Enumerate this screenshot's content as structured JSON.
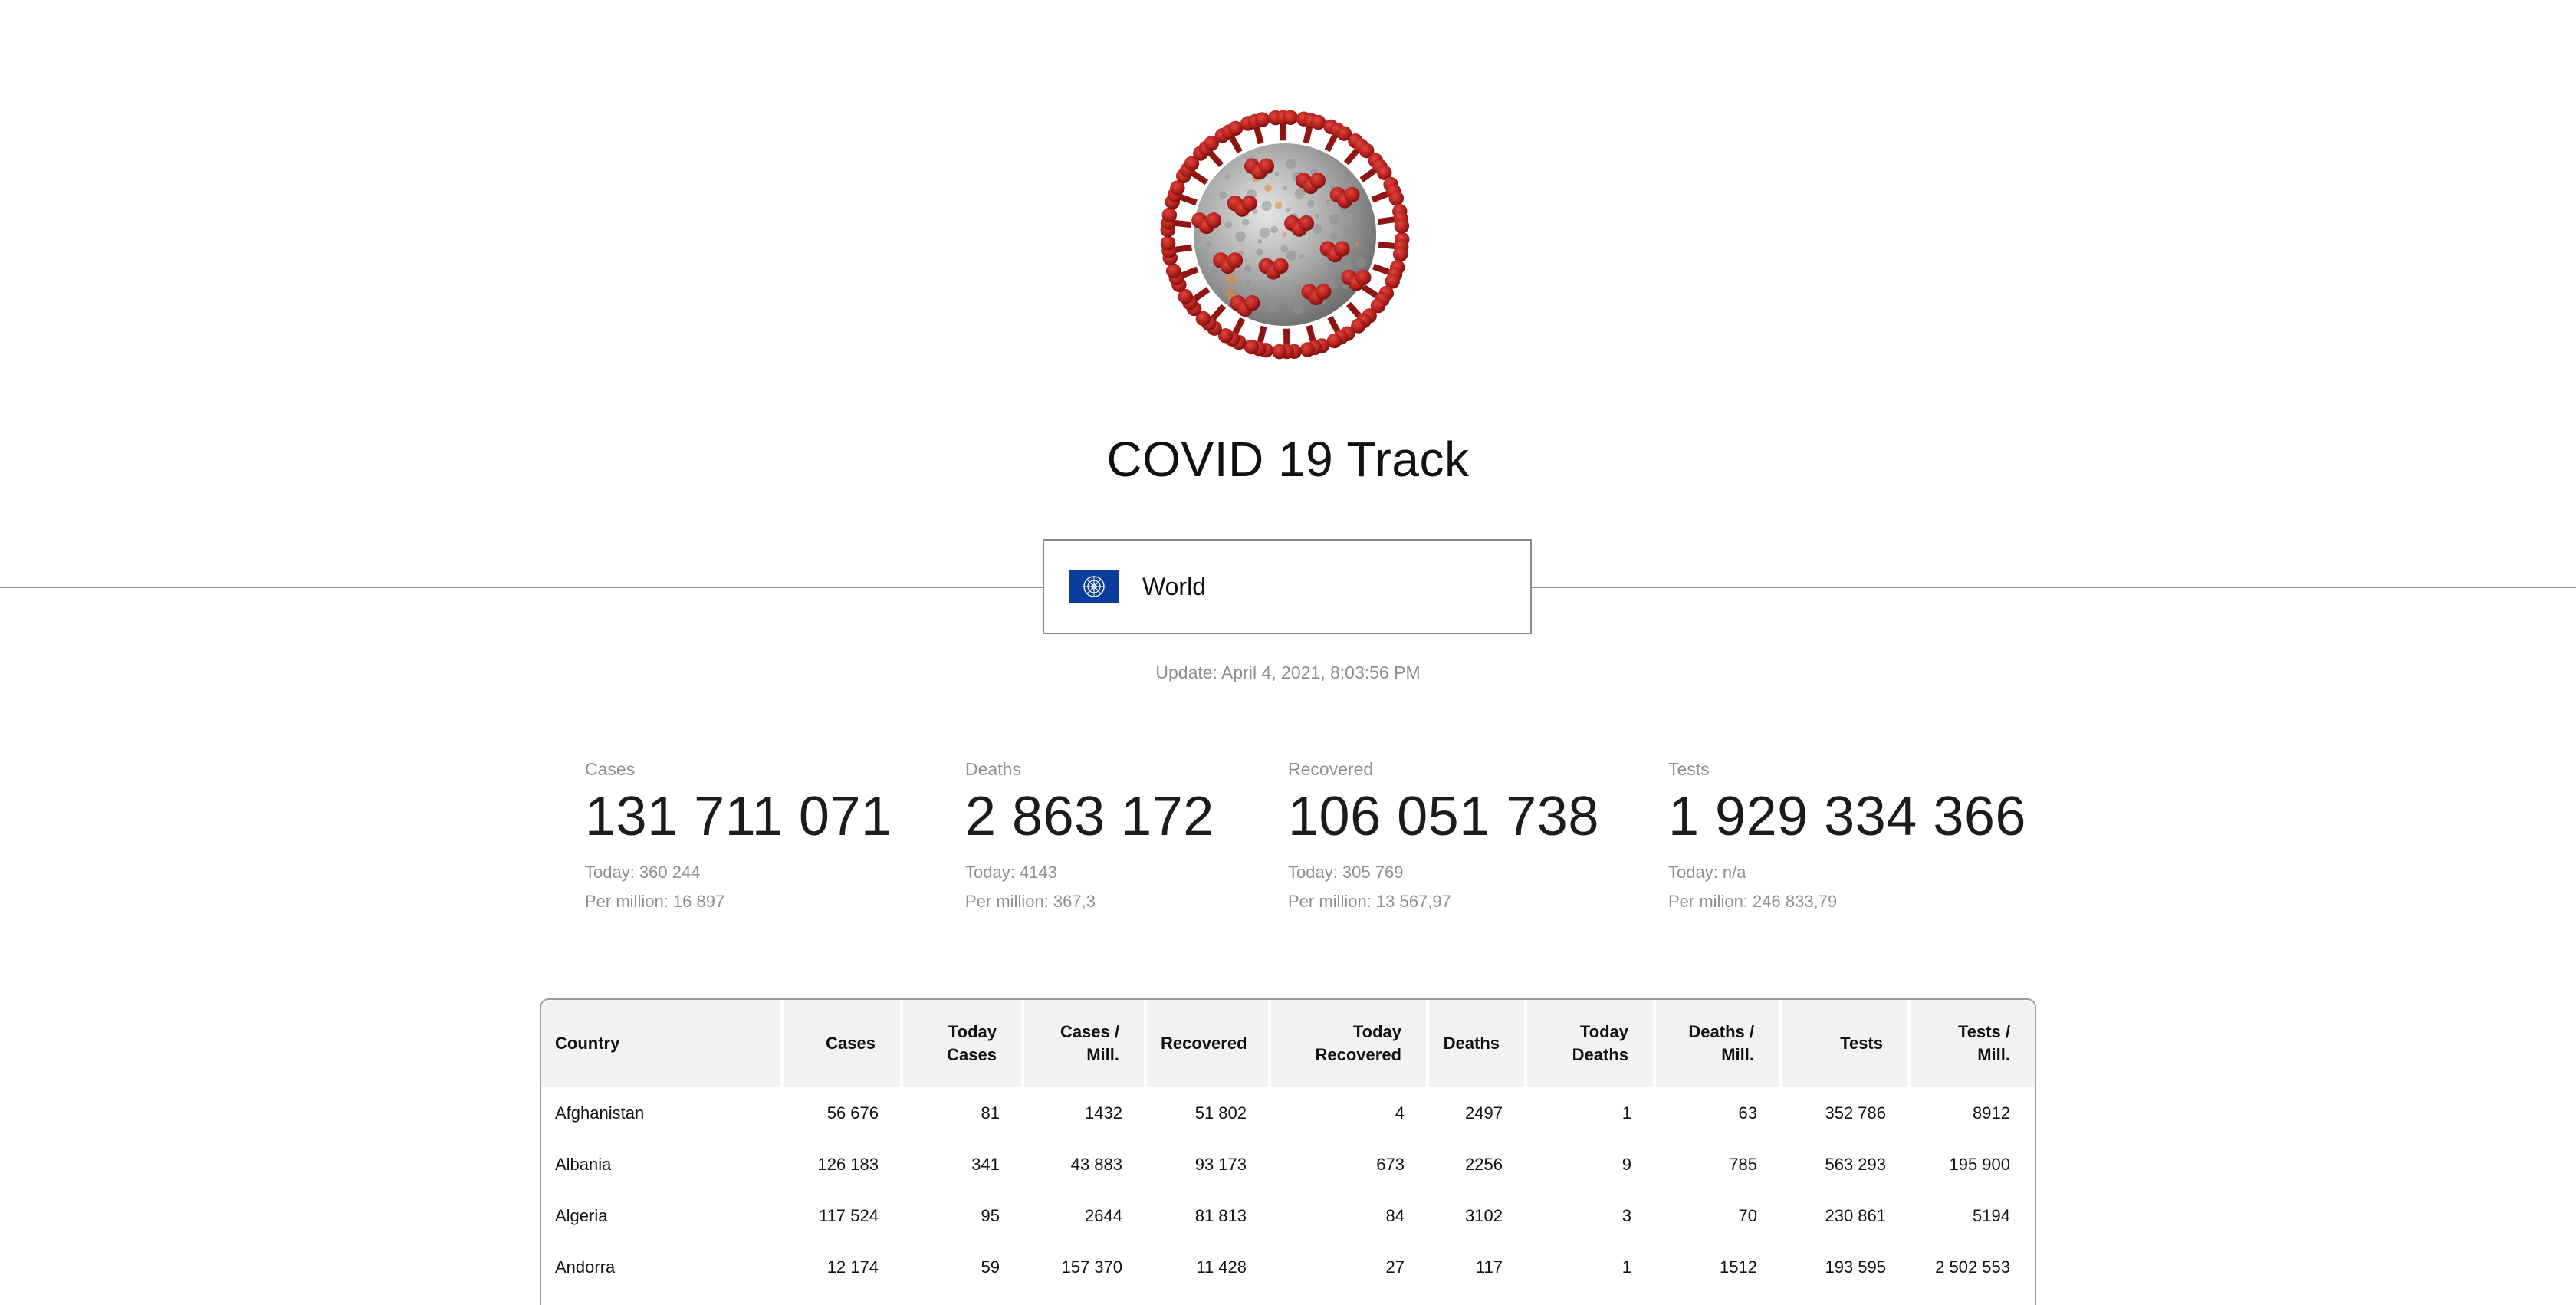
{
  "app": {
    "title": "COVID 19 Track"
  },
  "selector": {
    "label": "World",
    "flag_color": "#0b3e9c"
  },
  "update_text": "Update: April 4, 2021, 8:03:56 PM",
  "stats": [
    {
      "label": "Cases",
      "value": "131 711 071",
      "today": "Today: 360 244",
      "per": "Per million: 16 897"
    },
    {
      "label": "Deaths",
      "value": "2 863 172",
      "today": "Today: 4143",
      "per": "Per million: 367,3"
    },
    {
      "label": "Recovered",
      "value": "106 051 738",
      "today": "Today: 305 769",
      "per": "Per million: 13 567,97"
    },
    {
      "label": "Tests",
      "value": "1 929 334 366",
      "today": "Today: n/a",
      "per": "Per milion: 246 833,79"
    }
  ],
  "table": {
    "headers": {
      "country": "Country",
      "cases": "Cases",
      "today_cases_1": "Today",
      "today_cases_2": "Cases",
      "cases_mill_1": "Cases /",
      "cases_mill_2": "Mill.",
      "recovered": "Recovered",
      "today_recovered_1": "Today",
      "today_recovered_2": "Recovered",
      "deaths": "Deaths",
      "today_deaths_1": "Today",
      "today_deaths_2": "Deaths",
      "deaths_mill_1": "Deaths /",
      "deaths_mill_2": "Mill.",
      "tests": "Tests",
      "tests_mill_1": "Tests /",
      "tests_mill_2": "Mill."
    },
    "rows": [
      {
        "country": "Afghanistan",
        "cases": "56 676",
        "today_cases": "81",
        "cases_mill": "1432",
        "recovered": "51 802",
        "today_recovered": "4",
        "deaths": "2497",
        "today_deaths": "1",
        "deaths_mill": "63",
        "tests": "352 786",
        "tests_mill": "8912"
      },
      {
        "country": "Albania",
        "cases": "126 183",
        "today_cases": "341",
        "cases_mill": "43 883",
        "recovered": "93 173",
        "today_recovered": "673",
        "deaths": "2256",
        "today_deaths": "9",
        "deaths_mill": "785",
        "tests": "563 293",
        "tests_mill": "195 900"
      },
      {
        "country": "Algeria",
        "cases": "117 524",
        "today_cases": "95",
        "cases_mill": "2644",
        "recovered": "81 813",
        "today_recovered": "84",
        "deaths": "3102",
        "today_deaths": "3",
        "deaths_mill": "70",
        "tests": "230 861",
        "tests_mill": "5194"
      },
      {
        "country": "Andorra",
        "cases": "12 174",
        "today_cases": "59",
        "cases_mill": "157 370",
        "recovered": "11 428",
        "today_recovered": "27",
        "deaths": "117",
        "today_deaths": "1",
        "deaths_mill": "1512",
        "tests": "193 595",
        "tests_mill": "2 502 553"
      }
    ]
  }
}
